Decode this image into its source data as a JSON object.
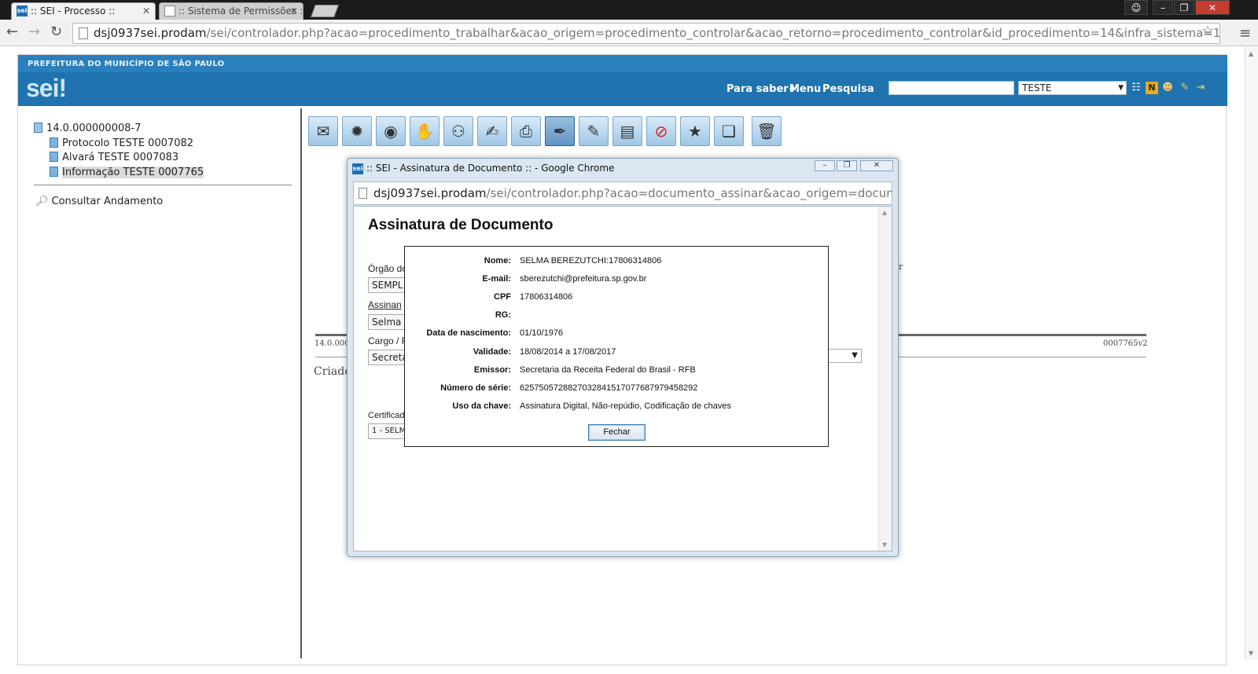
{
  "browser": {
    "tabs": [
      {
        "label": ":: SEI - Processo ::",
        "favicon": "sei"
      },
      {
        "label": ":: Sistema de Permissões ::",
        "favicon": "doc"
      }
    ],
    "url_host": "dsj0937sei.prodam",
    "url_path": "/sei/controlador.php?acao=procedimento_trabalhar&acao_origem=procedimento_controlar&acao_retorno=procedimento_controlar&id_procedimento=14&infra_sistema=100000100&"
  },
  "header": {
    "org_name": "PREFEITURA DO MUNICÍPIO DE SÃO PAULO",
    "logo": "sei",
    "logo_mark": "!",
    "links": [
      "Para saber+",
      "Menu",
      "Pesquisa"
    ],
    "unit_select": "TESTE"
  },
  "tree": {
    "root": "14.0.000000008-7",
    "docs": [
      "Protocolo TESTE 0007082",
      "Alvará TESTE 0007083",
      "Informação TESTE 0007765"
    ]
  },
  "sidebar": {
    "consult_label": "Consultar Andamento"
  },
  "document": {
    "left_code": "14.0.000",
    "right_code": "0007765v2",
    "created": "Criado",
    "email_tail": "br"
  },
  "popup": {
    "title": ":: SEI - Assinatura de Documento :: - Google Chrome",
    "url_host": "dsj0937sei.prodam",
    "url_path": "/sei/controlador.php?acao=documento_assinar&acao_origem=documento_as",
    "heading": "Assinatura de Documento",
    "fields": {
      "orgao_label": "Órgão do",
      "orgao_value": "SEMPL",
      "assinante_label": "Assinan",
      "assinante_value": "Selma B",
      "cargo_label": "Cargo / F",
      "cargo_value": "Secretá",
      "certificado_label": "Certificado",
      "certificado_value": "1 - SELMA"
    }
  },
  "certificate": {
    "rows": [
      {
        "label": "Nome:",
        "value": "SELMA BEREZUTCHI:17806314806"
      },
      {
        "label": "E-mail:",
        "value": "sberezutchi@prefeitura.sp.gov.br"
      },
      {
        "label": "CPF",
        "value": "17806314806"
      },
      {
        "label": "RG:",
        "value": ""
      },
      {
        "label": "Data de nascimento:",
        "value": "01/10/1976"
      },
      {
        "label": "Validade:",
        "value": "18/08/2014 a 17/08/2017"
      },
      {
        "label": "Emissor:",
        "value": "Secretaria da Receita Federal do Brasil - RFB"
      },
      {
        "label": "Número de série:",
        "value": "6257505728827032841517077687979458292"
      },
      {
        "label": "Uso da chave:",
        "value": "Assinatura Digital, Não-repúdio, Codificação de chaves"
      }
    ],
    "close_label": "Fechar"
  },
  "colors": {
    "header_blue": "#1f73ae",
    "header_band": "#2a7fbd",
    "dialog_border": "#222222"
  },
  "icons": [
    "envelope-icon",
    "colors-icon",
    "eye-icon",
    "thumbs-icon",
    "people-icon",
    "scroll-icon",
    "globe-printer-icon",
    "pen-icon",
    "sign-icon",
    "books-icon",
    "cancel-icon",
    "favorite-doc-icon",
    "copy-icon",
    "trash-icon"
  ]
}
